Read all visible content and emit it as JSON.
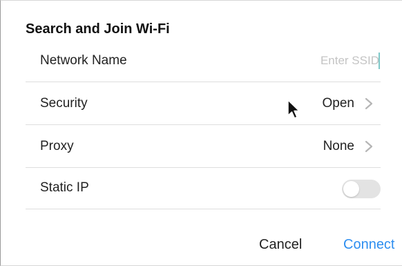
{
  "dialog": {
    "title": "Search and Join Wi-Fi",
    "network_name": {
      "label": "Network Name",
      "value": "",
      "placeholder": "Enter SSID"
    },
    "security": {
      "label": "Security",
      "value": "Open",
      "icon": "chevron-right-icon"
    },
    "proxy": {
      "label": "Proxy",
      "value": "None",
      "icon": "chevron-right-icon"
    },
    "static_ip": {
      "label": "Static IP",
      "enabled": false
    },
    "buttons": {
      "cancel": "Cancel",
      "connect": "Connect"
    },
    "colors": {
      "accent": "#2d8ef0",
      "caret": "#7ec8c8",
      "toggle_off": "#e3e3e3"
    }
  },
  "cursor": {
    "icon": "mouse-pointer-icon"
  }
}
